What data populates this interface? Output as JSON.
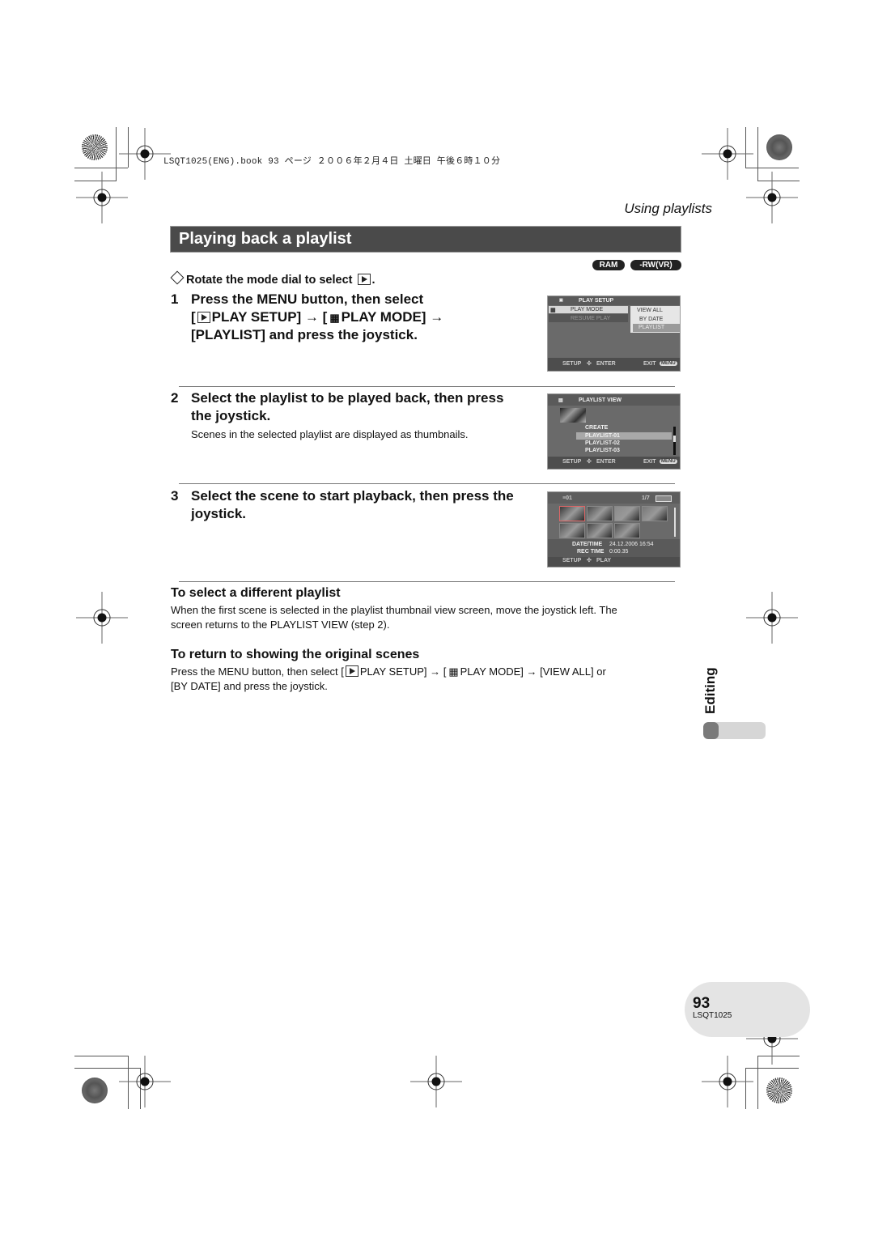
{
  "print_header": {
    "text": "LSQT1025(ENG).book  93 ページ  ２００６年２月４日  土曜日  午後６時１０分"
  },
  "section_label": "Using playlists",
  "page_title": "Playing back a playlist",
  "media_badges": [
    "RAM",
    "-RW(VR)"
  ],
  "intro": {
    "icon": "diamond-icon",
    "text": "Rotate the mode dial to select",
    "icon_after": "play-mode-icon",
    "suffix": "."
  },
  "steps": [
    {
      "number": "1",
      "lines": [
        {
          "parts": [
            "Press the MENU button, then select"
          ]
        },
        {
          "parts": [
            "[",
            "PLAY SETUP] → [",
            "PLAY MODE] →"
          ]
        },
        {
          "parts": [
            "[PLAYLIST] and press the joystick."
          ]
        }
      ],
      "note": ""
    },
    {
      "number": "2",
      "lines": [
        {
          "parts": [
            "Select the playlist to be played back, then press"
          ]
        },
        {
          "parts": [
            "the joystick."
          ]
        }
      ],
      "note": "Scenes in the selected playlist are displayed as thumbnails."
    },
    {
      "number": "3",
      "lines": [
        {
          "parts": [
            "Select the scene to start playback, then press the"
          ]
        },
        {
          "parts": [
            "joystick."
          ]
        }
      ],
      "note": ""
    }
  ],
  "screens": {
    "play_setup": {
      "title": "PLAY SETUP",
      "menu_items": [
        "PLAY MODE",
        "RESUME PLAY"
      ],
      "options": [
        "VIEW ALL",
        "BY DATE",
        "PLAYLIST"
      ],
      "selected_option": "PLAYLIST",
      "footer_left": "SETUP",
      "footer_mid": "ENTER",
      "footer_right": "EXIT",
      "menu_badge": "MENU"
    },
    "playlist_view": {
      "title": "PLAYLIST VIEW",
      "items": [
        "CREATE",
        "PLAYLIST-01",
        "PLAYLIST-02",
        "PLAYLIST-03"
      ],
      "selected_item": "PLAYLIST-01",
      "footer_left": "SETUP",
      "footer_mid": "ENTER",
      "footer_right": "EXIT",
      "menu_badge": "MENU"
    },
    "thumbnails": {
      "header_left": "≡01",
      "header_right": "1/7",
      "thumbnail_count": 7,
      "date_time_label": "DATE/TIME",
      "date_time_value": "24.12.2006  16:54",
      "rec_time_label": "REC TIME",
      "rec_time_value": "0:00.35",
      "footer_left": "SETUP",
      "footer_mid": "PLAY"
    }
  },
  "tips": [
    {
      "heading": "To select a different playlist",
      "lines": [
        "When the first scene is selected in the playlist thumbnail view screen, move the joystick left. The",
        "screen returns to the PLAYLIST VIEW (step 2)."
      ]
    },
    {
      "heading": "To return to showing the original scenes",
      "line1_parts": [
        "Press the MENU button, then select [",
        "PLAY SETUP] → [",
        "PLAY MODE] → [VIEW ALL] or"
      ],
      "line2": "[BY DATE] and press the joystick."
    }
  ],
  "side_tab": {
    "label": "Editing",
    "progress_fraction": 0.25
  },
  "footer": {
    "page_number": "93",
    "doc_code": "LSQT1025"
  }
}
